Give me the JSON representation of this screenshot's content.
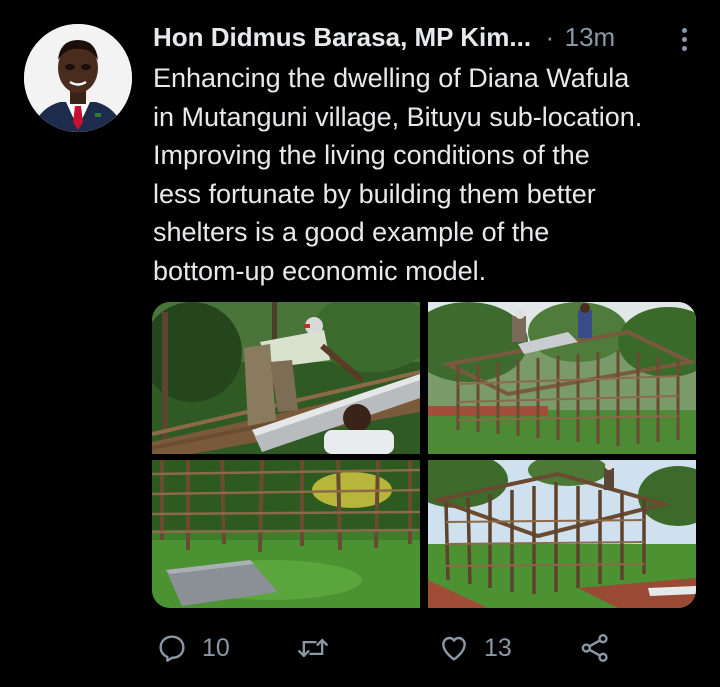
{
  "tweet": {
    "author": "Hon Didmus Barasa, MP Kim...",
    "separator": "·",
    "time": "13m",
    "text_lines": [
      "Enhancing the dwelling of Diana Wafula",
      "in Mutanguni village, Bituyu sub-location.",
      "Improving the living conditions of the",
      "less fortunate by building them better",
      "shelters is a good example of the",
      "bottom-up economic model."
    ]
  },
  "actions": {
    "reply_count": "10",
    "retweet_count": "",
    "like_count": "13"
  },
  "icons": {
    "more": "more-vertical-icon",
    "reply": "reply-icon",
    "retweet": "retweet-icon",
    "like": "heart-icon",
    "share": "share-icon"
  },
  "colors": {
    "background": "#000000",
    "text": "#e7e9ea",
    "secondary": "#8b98a5"
  }
}
